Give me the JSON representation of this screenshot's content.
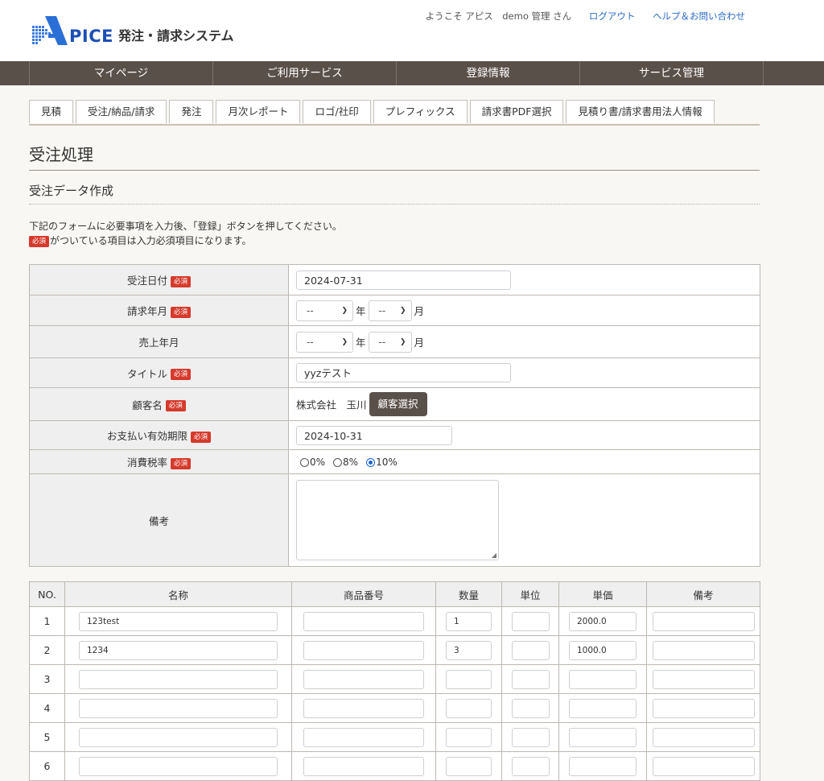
{
  "header": {
    "logo_text": "PICE",
    "logo_sub": "発注・請求システム",
    "welcome": "ようこそ アピス　demo 管理 さん",
    "logout": "ログアウト",
    "help": "ヘルプ＆お問い合わせ"
  },
  "gnav": [
    {
      "label": "マイページ"
    },
    {
      "label": "ご利用サービス"
    },
    {
      "label": "登録情報"
    },
    {
      "label": "サービス管理"
    }
  ],
  "tabs": [
    {
      "label": "見積"
    },
    {
      "label": "受注/納品/請求"
    },
    {
      "label": "発注"
    },
    {
      "label": "月次レポート"
    },
    {
      "label": "ロゴ/社印"
    },
    {
      "label": "プレフィックス"
    },
    {
      "label": "請求書PDF選択"
    },
    {
      "label": "見積り書/請求書用法人情報"
    }
  ],
  "page_title": "受注処理",
  "subtitle": "受注データ作成",
  "note_line1": "下記のフォームに必要事項を入力後、「登録」ボタンを押してください。",
  "note_line2": "がついている項目は入力必須項目になります。",
  "required_badge": "必須",
  "form": {
    "order_date": {
      "label": "受注日付",
      "value": "2024-07-31"
    },
    "billing_month": {
      "label": "請求年月",
      "year_value": "--",
      "month_value": "--",
      "year_unit": "年",
      "month_unit": "月"
    },
    "sales_month": {
      "label": "売上年月",
      "year_value": "--",
      "month_value": "--",
      "year_unit": "年",
      "month_unit": "月"
    },
    "title": {
      "label": "タイトル",
      "value": "yyzテスト"
    },
    "customer": {
      "label": "顧客名",
      "value": "株式会社　玉川",
      "button": "顧客選択"
    },
    "due_date": {
      "label": "お支払い有効期限",
      "value": "2024-10-31"
    },
    "tax": {
      "label": "消費税率",
      "options": [
        "0%",
        "8%",
        "10%"
      ],
      "selected": "10%"
    },
    "remarks": {
      "label": "備考",
      "value": ""
    }
  },
  "items_table": {
    "headers": [
      "NO.",
      "名称",
      "商品番号",
      "数量",
      "単位",
      "単価",
      "備考"
    ],
    "rows": [
      {
        "no": "1",
        "name": "123test",
        "code": "",
        "qty": "1",
        "unit": "",
        "price": "2000.0",
        "note": ""
      },
      {
        "no": "2",
        "name": "1234",
        "code": "",
        "qty": "3",
        "unit": "",
        "price": "1000.0",
        "note": ""
      },
      {
        "no": "3",
        "name": "",
        "code": "",
        "qty": "",
        "unit": "",
        "price": "",
        "note": ""
      },
      {
        "no": "4",
        "name": "",
        "code": "",
        "qty": "",
        "unit": "",
        "price": "",
        "note": ""
      },
      {
        "no": "5",
        "name": "",
        "code": "",
        "qty": "",
        "unit": "",
        "price": "",
        "note": ""
      },
      {
        "no": "6",
        "name": "",
        "code": "",
        "qty": "",
        "unit": "",
        "price": "",
        "note": ""
      }
    ]
  },
  "colors": {
    "nav_bg": "#5a504a",
    "required": "#d63a2c",
    "link": "#2a6bc4",
    "logo": "#1b4fb5"
  }
}
